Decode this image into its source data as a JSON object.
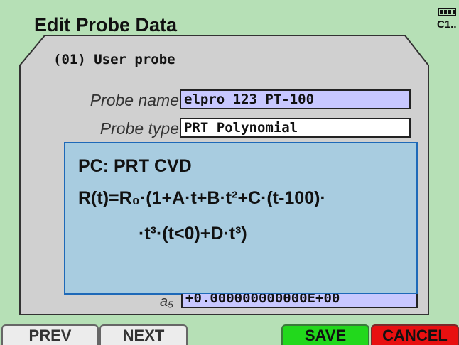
{
  "header": {
    "title": "Edit Probe Data",
    "channel": "C1..",
    "battery_icon": "battery-icon"
  },
  "probe": {
    "header": "(01) User probe",
    "name_label": "Probe name",
    "name_value": "elpro 123 PT-100",
    "type_label": "Probe type",
    "type_value": "PRT Polynomial"
  },
  "popup": {
    "title": "PC: PRT CVD",
    "formula_line1": "R(t)=R₀·(1+A·t+B·t²+C·(t-100)·",
    "formula_line2": "·t³·(t<0)+D·t³)"
  },
  "coefficient": {
    "label": "a₅",
    "value": "+0.000000000000E+00"
  },
  "buttons": {
    "prev": "PREV",
    "next": "NEXT",
    "save": "SAVE",
    "cancel": "CANCEL"
  },
  "colors": {
    "background": "#b6e0b6",
    "panel": "#d0d0d0",
    "popup": "#a8cce0",
    "popup_border": "#1e69b8",
    "selected_field": "#c8c8ff",
    "save": "#22d81c",
    "cancel": "#e81010"
  }
}
